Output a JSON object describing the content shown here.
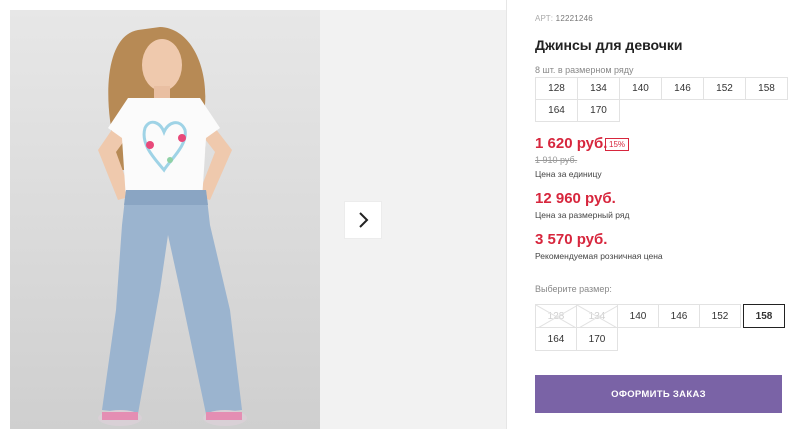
{
  "product": {
    "article_label": "АРТ:",
    "article_value": "12221246",
    "title": "Джинсы для девочки",
    "pieces_note": "8 шт. в размерном ряду",
    "size_row": [
      "128",
      "134",
      "140",
      "146",
      "152",
      "158",
      "164",
      "170"
    ]
  },
  "prices": {
    "unit_price": "1 620 руб.",
    "discount": "15%",
    "old_price": "1 910 руб.",
    "unit_caption": "Цена за единицу",
    "row_price": "12 960 руб.",
    "row_caption": "Цена за размерный ряд",
    "retail_price": "3 570 руб.",
    "retail_caption": "Рекомендуемая розничная цена"
  },
  "size_picker": {
    "label": "Выберите размер:",
    "options": [
      {
        "label": "128",
        "state": "disabled"
      },
      {
        "label": "134",
        "state": "disabled"
      },
      {
        "label": "140",
        "state": "available"
      },
      {
        "label": "146",
        "state": "available"
      },
      {
        "label": "152",
        "state": "available"
      },
      {
        "label": "158",
        "state": "selected"
      },
      {
        "label": "164",
        "state": "available"
      },
      {
        "label": "170",
        "state": "available"
      }
    ]
  },
  "order_button": "ОФОРМИТЬ ЗАКАЗ",
  "gallery": {
    "next_icon": "chevron-right-icon"
  },
  "colors": {
    "price_red": "#d7263d",
    "button_purple": "#7a63a6"
  }
}
